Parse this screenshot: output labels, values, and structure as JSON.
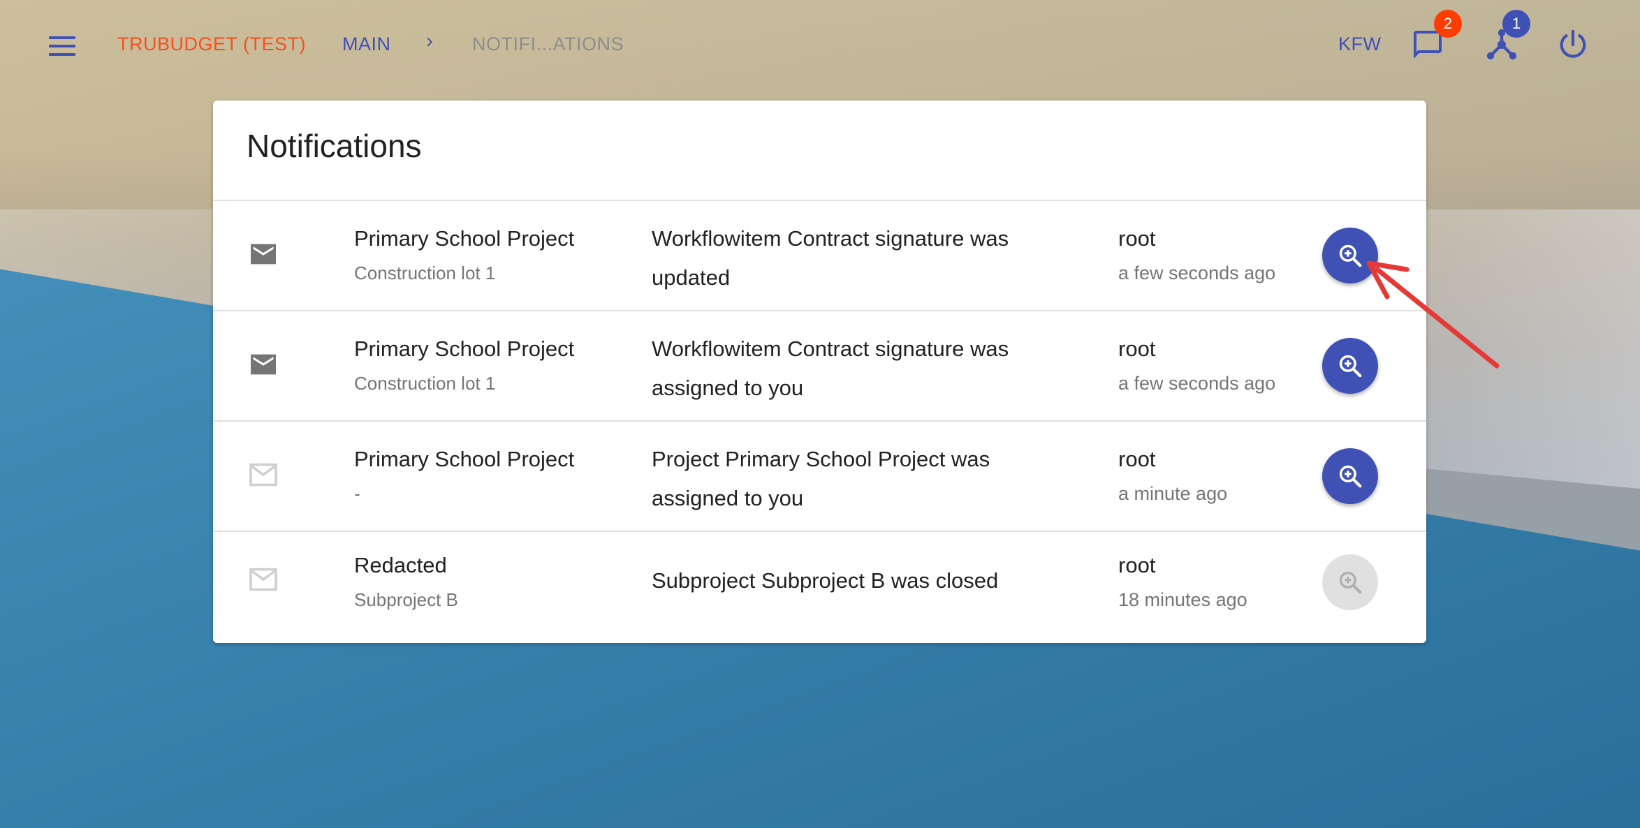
{
  "app": {
    "title": "TRUBUDGET (TEST)",
    "breadcrumb_main": "MAIN",
    "breadcrumb_separator": "›",
    "breadcrumb_current": "NOTIFI...ATIONS",
    "organization": "KFW",
    "notification_count": "2",
    "peers_count": "1"
  },
  "colors": {
    "primary": "#3f51b5",
    "accent": "#f4511e",
    "badge_notifications": "#ff3d00",
    "badge_peers": "#3f51b5",
    "annotation_arrow": "#e53935"
  },
  "notifications": {
    "title": "Notifications",
    "rows": [
      {
        "read": false,
        "project": "Primary School Project",
        "subproject": "Construction lot 1",
        "message": "Workflowitem Contract signature was updated",
        "user": "root",
        "time": "a few seconds ago",
        "view_enabled": true
      },
      {
        "read": false,
        "project": "Primary School Project",
        "subproject": "Construction lot 1",
        "message": "Workflowitem Contract signature was assigned to you",
        "user": "root",
        "time": "a few seconds ago",
        "view_enabled": true
      },
      {
        "read": true,
        "project": "Primary School Project",
        "subproject": "-",
        "message": "Project Primary School Project was assigned to you",
        "user": "root",
        "time": "a minute ago",
        "view_enabled": true
      },
      {
        "read": true,
        "project": "Redacted",
        "subproject": "Subproject B",
        "message": "Subproject Subproject B was closed",
        "user": "root",
        "time": "18 minutes ago",
        "view_enabled": false
      }
    ]
  },
  "icons": {
    "menu": "menu-icon",
    "notifications": "chat-icon",
    "peers": "network-icon",
    "logout": "power-icon",
    "mail": "mail-icon",
    "view": "zoom-in-icon"
  }
}
